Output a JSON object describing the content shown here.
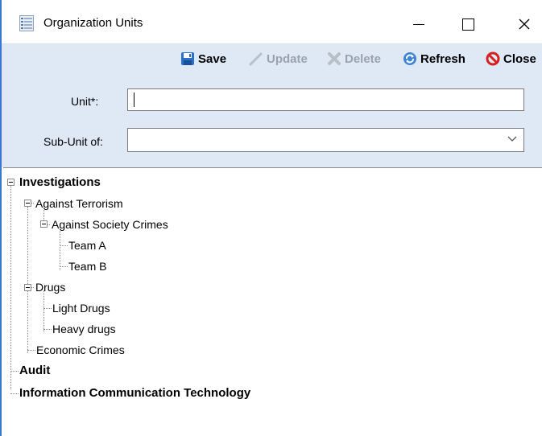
{
  "window": {
    "title": "Organization Units",
    "app_icon": "list-icon",
    "controls": {
      "minimize": "minimize-icon",
      "maximize": "maximize-icon",
      "close": "close-icon"
    }
  },
  "toolbar": {
    "save_label": "Save",
    "update_label": "Update",
    "delete_label": "Delete",
    "refresh_label": "Refresh",
    "close_label": "Close"
  },
  "form": {
    "unit_label": "Unit*:",
    "unit_value": "",
    "sub_unit_label": "Sub-Unit of:",
    "sub_unit_value": ""
  },
  "tree": {
    "nodes": [
      {
        "label": "Investigations",
        "level": 0,
        "bold": true,
        "expanded": true
      },
      {
        "label": "Against Terrorism",
        "level": 1,
        "bold": false,
        "expanded": true
      },
      {
        "label": "Against Society Crimes",
        "level": 2,
        "bold": false,
        "expanded": true
      },
      {
        "label": "Team A",
        "level": 3,
        "bold": false
      },
      {
        "label": "Team B",
        "level": 3,
        "bold": false
      },
      {
        "label": "Drugs",
        "level": 1,
        "bold": false,
        "expanded": true
      },
      {
        "label": "Light Drugs",
        "level": 2,
        "bold": false
      },
      {
        "label": "Heavy drugs",
        "level": 2,
        "bold": false
      },
      {
        "label": "Economic Crimes",
        "level": 1,
        "bold": false
      },
      {
        "label": "Audit",
        "level": 0,
        "bold": true
      },
      {
        "label": "Information Communication Technology",
        "level": 0,
        "bold": true
      }
    ]
  },
  "colors": {
    "toolbar_bg": "#dfe9f5",
    "window_border": "#3a78d0",
    "disabled_text": "#9aa3ad",
    "close_red": "#d62020",
    "save_blue": "#2a6fc9"
  }
}
